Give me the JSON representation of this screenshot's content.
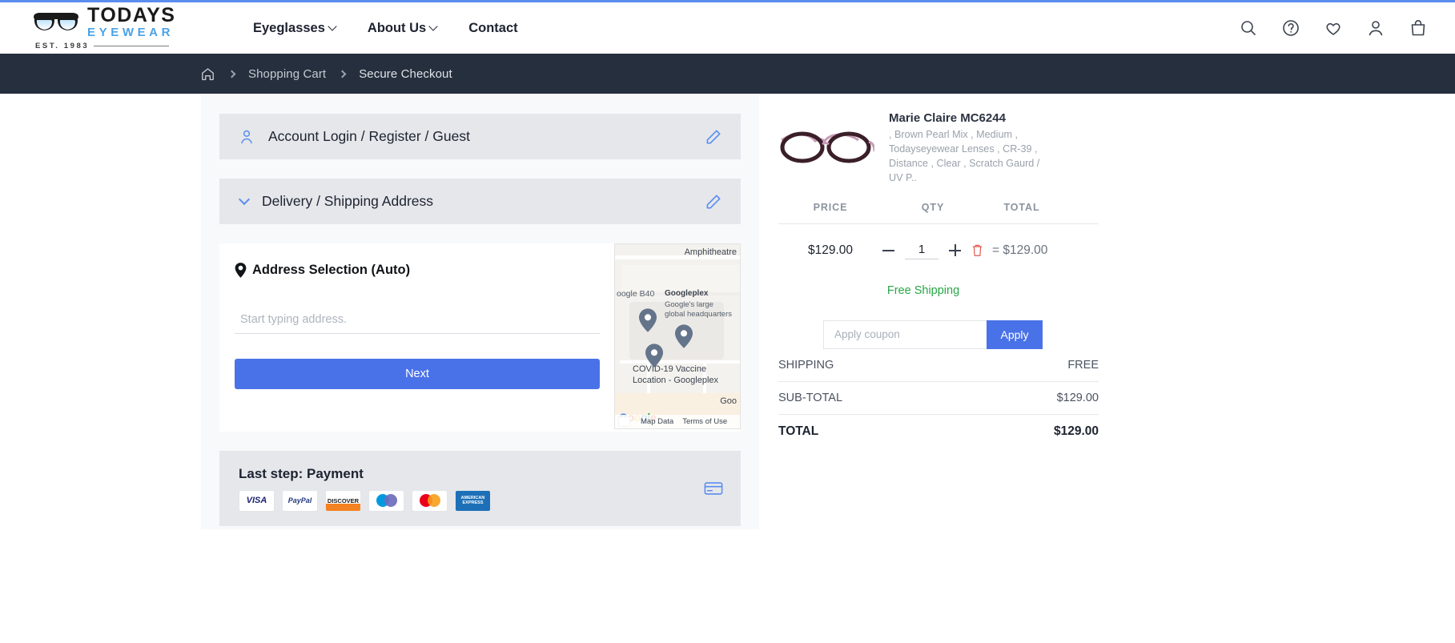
{
  "brand": {
    "name_top": "TODAYS",
    "name_bottom": "EYEWEAR",
    "est": "EST. 1983"
  },
  "nav": {
    "items": [
      {
        "label": "Eyeglasses",
        "has_caret": true
      },
      {
        "label": "About Us",
        "has_caret": true
      },
      {
        "label": "Contact",
        "has_caret": false
      }
    ],
    "icons": [
      "search-icon",
      "help-icon",
      "wishlist-heart-icon",
      "account-icon",
      "bag-icon"
    ]
  },
  "breadcrumb": {
    "home": "home-icon",
    "items": [
      "Shopping Cart",
      "Secure Checkout"
    ]
  },
  "checkout": {
    "account_section": {
      "title": "Account Login / Register / Guest",
      "edit_label": "edit-icon"
    },
    "delivery_section": {
      "title": "Delivery / Shipping Address",
      "edit_label": "edit-icon"
    },
    "address": {
      "heading": "Address Selection (Auto)",
      "input_value": "",
      "input_placeholder": "Start typing address.",
      "next_label": "Next"
    },
    "payment_section": {
      "title": "Last step: Payment",
      "cards": [
        {
          "name": "visa",
          "label": "VISA"
        },
        {
          "name": "paypal",
          "label": "PayPal"
        },
        {
          "name": "discover",
          "label": "DISCOVER"
        },
        {
          "name": "maestro",
          "label": "Maestro"
        },
        {
          "name": "mastercard",
          "label": "MasterCard"
        },
        {
          "name": "amex",
          "label": "AMERICAN EXPRESS"
        }
      ]
    }
  },
  "map": {
    "labels": {
      "amphitheatre": "Amphitheatre",
      "google_b40": "oogle B40",
      "googleplex": "Googleplex",
      "googleplex_sub1": "Google's large",
      "googleplex_sub2": "global headquarters",
      "covid1": "COVID-19 Vaccine",
      "covid2": "Location - Googleplex",
      "goo": "Goo"
    },
    "watermark": "Google",
    "footer": {
      "map_data": "Map Data",
      "terms": "Terms of Use"
    }
  },
  "summary": {
    "product": {
      "name": "Marie Claire MC6244",
      "specs": ", Brown Pearl Mix , Medium , Todayseyewear Lenses , CR-39 , Distance , Clear , Scratch Gaurd / UV P..",
      "image_alt": "eyeglasses-product-image"
    },
    "columns": [
      "PRICE",
      "QTY",
      "TOTAL"
    ],
    "price": "$129.00",
    "qty": "1",
    "line_total": "$129.00",
    "equals": "=",
    "free_shipping": "Free Shipping",
    "coupon_placeholder": "Apply coupon",
    "coupon_value": "",
    "apply_label": "Apply",
    "totals": [
      {
        "label": "SHIPPING",
        "value": "FREE"
      },
      {
        "label": "SUB-TOTAL",
        "value": "$129.00"
      },
      {
        "label": "TOTAL",
        "value": "$129.00"
      }
    ]
  },
  "colors": {
    "accent_blue": "#4a72e8",
    "logo_blue": "#4aa3e8",
    "crumb_bar": "#262f3d",
    "green": "#27a745",
    "trash_red": "#e2574c"
  }
}
